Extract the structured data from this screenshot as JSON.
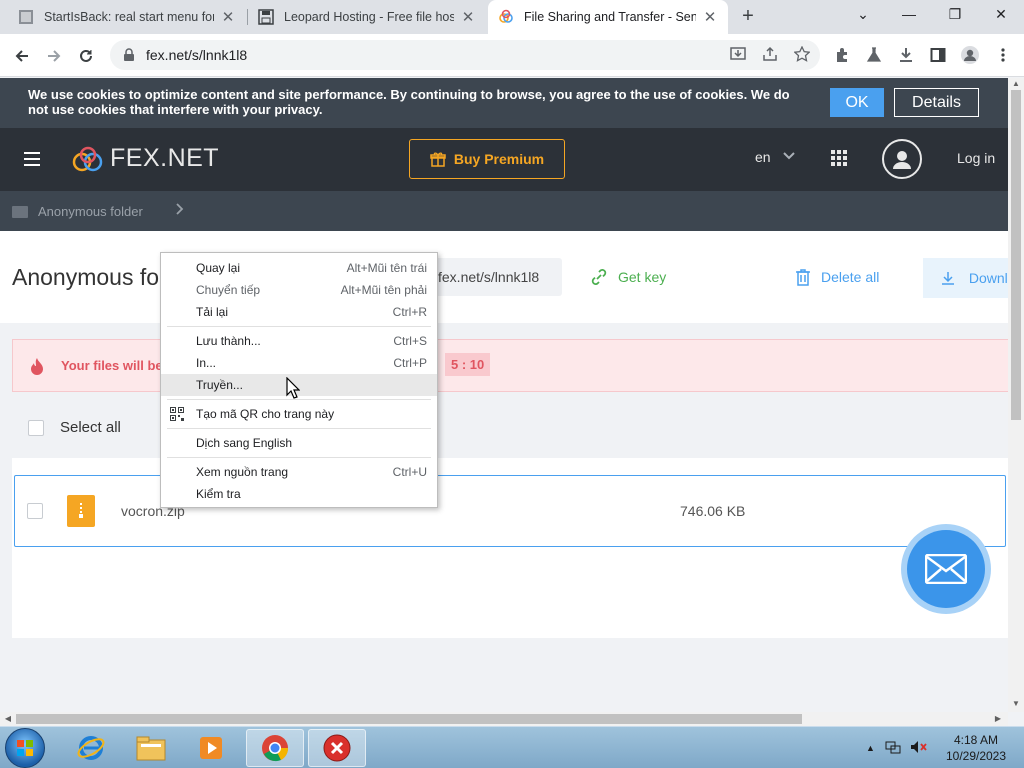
{
  "browser": {
    "tabs": [
      {
        "title": "StartIsBack: real start menu for W",
        "active": false
      },
      {
        "title": "Leopard Hosting - Free file hosti",
        "active": false
      },
      {
        "title": "File Sharing and Transfer - Send",
        "active": true
      }
    ],
    "new_tab": "+",
    "url": "fex.net/s/lnnk1l8"
  },
  "cookie_bar": {
    "text": "We use cookies to optimize content and site performance. By continuing to browse, you agree to the use of cookies. We do not use cookies that interfere with your privacy.",
    "ok": "OK",
    "details": "Details"
  },
  "header": {
    "logo": "FEX.NET",
    "premium": "Buy Premium",
    "lang": "en",
    "login": "Log in"
  },
  "breadcrumb": {
    "folder": "Anonymous folder"
  },
  "toolbar_row": {
    "title": "Anonymous folder",
    "link": "fex.net/s/lnnk1l8",
    "get_key": "Get key",
    "delete_all": "Delete all",
    "download": "Download"
  },
  "warning": {
    "text": "Your files will be",
    "timer": "5 : 10"
  },
  "list": {
    "select_all": "Select all",
    "files": [
      {
        "name": "vocron.zip",
        "size": "746.06 KB"
      }
    ]
  },
  "context_menu": {
    "items": [
      {
        "label": "Quay lại",
        "shortcut": "Alt+Mũi tên trái"
      },
      {
        "label": "Chuyển tiếp",
        "shortcut": "Alt+Mũi tên phải"
      },
      {
        "label": "Tải lại",
        "shortcut": "Ctrl+R"
      },
      {
        "label": "Lưu thành...",
        "shortcut": "Ctrl+S"
      },
      {
        "label": "In...",
        "shortcut": "Ctrl+P"
      },
      {
        "label": "Truyền...",
        "shortcut": ""
      },
      {
        "label": "Tạo mã QR cho trang này",
        "shortcut": ""
      },
      {
        "label": "Dịch sang English",
        "shortcut": ""
      },
      {
        "label": "Xem nguồn trang",
        "shortcut": "Ctrl+U"
      },
      {
        "label": "Kiểm tra",
        "shortcut": ""
      }
    ]
  },
  "taskbar": {
    "time": "4:18 AM",
    "date": "10/29/2023"
  },
  "colors": {
    "brand_blue": "#4aa0ef",
    "premium_orange": "#f5a623",
    "header_dark": "#2c3138",
    "warning_red": "#e05560"
  }
}
